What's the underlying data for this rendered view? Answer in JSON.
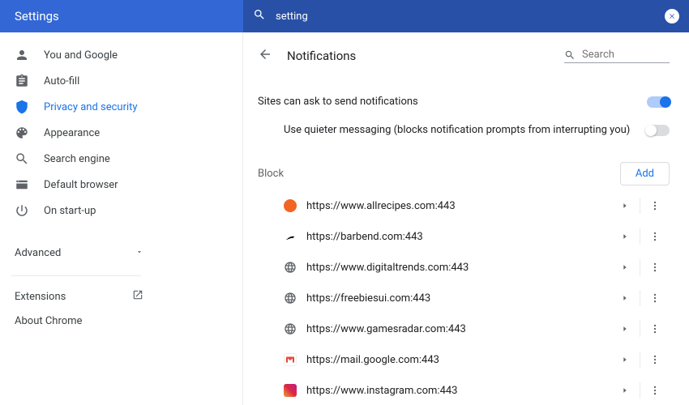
{
  "header": {
    "title": "Settings",
    "search_value": "setting"
  },
  "sidebar": {
    "items": [
      {
        "label": "You and Google",
        "icon": "person"
      },
      {
        "label": "Auto-fill",
        "icon": "assignment"
      },
      {
        "label": "Privacy and security",
        "icon": "shield",
        "active": true
      },
      {
        "label": "Appearance",
        "icon": "palette"
      },
      {
        "label": "Search engine",
        "icon": "search"
      },
      {
        "label": "Default browser",
        "icon": "browser"
      },
      {
        "label": "On start-up",
        "icon": "power"
      }
    ],
    "advanced_label": "Advanced",
    "extensions_label": "Extensions",
    "about_label": "About Chrome"
  },
  "page": {
    "title": "Notifications",
    "sub_search_placeholder": "Search",
    "setting_ask": "Sites can ask to send notifications",
    "setting_quiet": "Use quieter messaging (blocks notification prompts from interrupting you)",
    "block_label": "Block",
    "add_label": "Add",
    "toggle_ask": true,
    "toggle_quiet": false
  },
  "block_list": [
    {
      "url": "https://www.allrecipes.com:443",
      "favicon": "allrecipes",
      "favicon_bg": "#f26522"
    },
    {
      "url": "https://barbend.com:443",
      "favicon": "barbend",
      "favicon_bg": "#000000"
    },
    {
      "url": "https://www.digitaltrends.com:443",
      "favicon": "globe"
    },
    {
      "url": "https://freebiesui.com:443",
      "favicon": "globe"
    },
    {
      "url": "https://www.gamesradar.com:443",
      "favicon": "globe"
    },
    {
      "url": "https://mail.google.com:443",
      "favicon": "gmail"
    },
    {
      "url": "https://www.instagram.com:443",
      "favicon": "instagram"
    }
  ]
}
